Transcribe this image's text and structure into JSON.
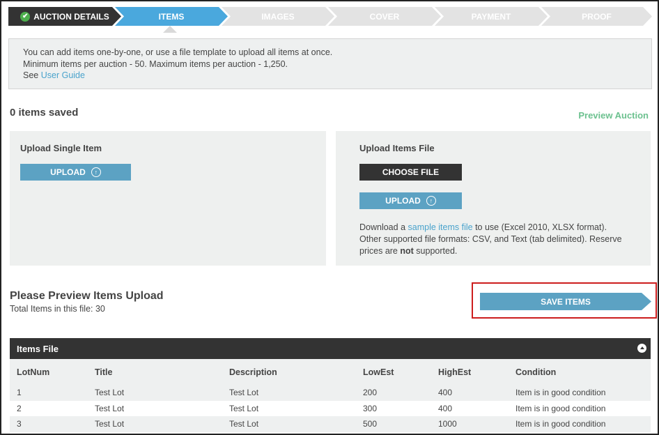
{
  "steps": [
    {
      "label": "AUCTION DETAILS",
      "state": "done"
    },
    {
      "label": "ITEMS",
      "state": "active"
    },
    {
      "label": "IMAGES",
      "state": "todo"
    },
    {
      "label": "COVER",
      "state": "todo"
    },
    {
      "label": "PAYMENT",
      "state": "todo"
    },
    {
      "label": "PROOF",
      "state": "todo"
    }
  ],
  "info": {
    "line1": "You can add items one-by-one, or use a file template to upload all items at once.",
    "line2": "Minimum items per auction - 50. Maximum items per auction - 1,250.",
    "see_label": "See",
    "user_guide_link": "User Guide"
  },
  "items_saved": "0 items saved",
  "preview_auction_link": "Preview Auction",
  "single_item_panel": {
    "title": "Upload Single Item",
    "upload_button": "UPLOAD"
  },
  "file_panel": {
    "title": "Upload Items File",
    "choose_file_button": "CHOOSE FILE",
    "upload_button": "UPLOAD",
    "download_prefix": "Download a",
    "sample_link": "sample items file",
    "download_suffix": "to use (Excel 2010, XLSX format).",
    "formats_text": "Other supported file formats: CSV, and Text (tab delimited). Reserve prices are",
    "not_word": "not",
    "supported_suffix": "supported."
  },
  "preview": {
    "title": "Please Preview Items Upload",
    "total_label": "Total Items in this file: 30",
    "save_button": "SAVE ITEMS"
  },
  "items_file": {
    "header": "Items File",
    "columns": [
      "LotNum",
      "Title",
      "Description",
      "LowEst",
      "HighEst",
      "Condition"
    ],
    "rows": [
      [
        "1",
        "Test Lot",
        "Test Lot",
        "200",
        "400",
        "Item is in good condition"
      ],
      [
        "2",
        "Test Lot",
        "Test Lot",
        "300",
        "400",
        "Item is in good condition"
      ],
      [
        "3",
        "Test Lot",
        "Test Lot",
        "500",
        "1000",
        "Item is in good condition"
      ]
    ]
  },
  "colors": {
    "active_step": "#4aa8dd",
    "done_step": "#333333",
    "button_blue": "#5ca2c3",
    "link_blue": "#4aa3cc",
    "preview_green": "#6cc18f",
    "highlight_red": "#cc1d1d"
  },
  "icons": {
    "done_check": "check-circle-icon",
    "upload": "upload-arrow-icon",
    "collapse": "collapse-up-icon"
  }
}
